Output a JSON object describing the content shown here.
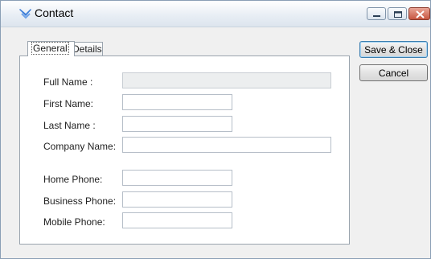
{
  "window": {
    "title": "Contact",
    "icon": "contact-app-icon",
    "controls": [
      "minimize-icon",
      "maximize-icon",
      "close-icon"
    ]
  },
  "tabs": [
    {
      "label": "General",
      "active": true
    },
    {
      "label": "Details",
      "active": false
    }
  ],
  "form": {
    "full_name": {
      "label": "Full Name :",
      "value": "",
      "readonly": true
    },
    "first_name": {
      "label": "First Name:",
      "value": ""
    },
    "last_name": {
      "label": "Last Name :",
      "value": ""
    },
    "company_name": {
      "label": "Company Name:",
      "value": ""
    },
    "home_phone": {
      "label": "Home Phone:",
      "value": ""
    },
    "business_phone": {
      "label": "Business Phone:",
      "value": ""
    },
    "mobile_phone": {
      "label": "Mobile Phone:",
      "value": ""
    }
  },
  "buttons": {
    "save_close": "Save & Close",
    "cancel": "Cancel"
  },
  "colors": {
    "close_button": "#c75640",
    "default_button_border": "#3c7fb1",
    "icon_blue": "#3b7dd8"
  }
}
